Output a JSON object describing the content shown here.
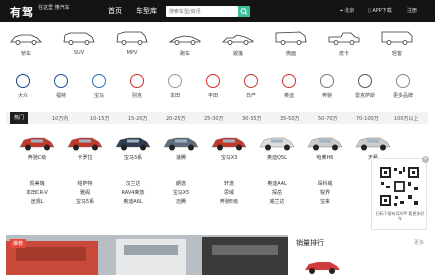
{
  "header": {
    "logo": "有驾",
    "slogan": "在这里 懂汽车",
    "nav_home": "首页",
    "nav_lib": "车型库",
    "search_placeholder": "搜索车型/资讯",
    "location": "北京",
    "app": "APP下载",
    "register": "注册"
  },
  "body_types": [
    {
      "label": "轿车",
      "icon": "sedan-icon"
    },
    {
      "label": "SUV",
      "icon": "suv-icon"
    },
    {
      "label": "MPV",
      "icon": "mpv-icon"
    },
    {
      "label": "跑车",
      "icon": "sports-car-icon"
    },
    {
      "label": "敞篷",
      "icon": "convertible-icon"
    },
    {
      "label": "微面",
      "icon": "van-icon"
    },
    {
      "label": "皮卡",
      "icon": "pickup-icon"
    },
    {
      "label": "轻客",
      "icon": "minibus-icon"
    }
  ],
  "brands": [
    {
      "label": "大众",
      "color": "#1b3f8b"
    },
    {
      "label": "福特",
      "color": "#1f4f9a"
    },
    {
      "label": "宝马",
      "color": "#2b6cb5"
    },
    {
      "label": "别克",
      "color": "#c9302c"
    },
    {
      "label": "本田",
      "color": "#999999"
    },
    {
      "label": "丰田",
      "color": "#d82b2b"
    },
    {
      "label": "日产",
      "color": "#c0392b"
    },
    {
      "label": "奥迪",
      "color": "#d32f2f"
    },
    {
      "label": "奔驰",
      "color": "#777777"
    },
    {
      "label": "雷克萨斯",
      "color": "#555555"
    },
    {
      "label": "更多品牌",
      "color": "#888888"
    }
  ],
  "tabs": [
    "热门",
    "10万内",
    "10-15万",
    "15-20万",
    "20-25万",
    "25-30万",
    "30-35万",
    "35-50万",
    "50-70万",
    "70-100万",
    "100万以上"
  ],
  "cars_row1": [
    {
      "name": "奔驰C级",
      "color": "#c0392b"
    },
    {
      "name": "卡罗拉",
      "color": "#c0392b"
    },
    {
      "name": "宝马3系",
      "color": "#2c3e50"
    },
    {
      "name": "速腾",
      "color": "#5d6d7e"
    },
    {
      "name": "宝马X3",
      "color": "#c0392b"
    },
    {
      "name": "奥迪Q5L",
      "color": "#dddddd"
    },
    {
      "name": "哈弗H6",
      "color": "#cccccc"
    },
    {
      "name": "天籁",
      "color": "#cccccc"
    }
  ],
  "cars_row2": [
    {
      "line1": "凯美瑞",
      "line2": "本田CR-V",
      "line3": "途观L"
    },
    {
      "line1": "帕萨特",
      "line2": "雅阁",
      "line3": "宝马5系"
    },
    {
      "line1": "汉兰达",
      "line2": "RAV4荣放",
      "line3": "奥迪A6L"
    },
    {
      "line1": "朗逸",
      "line2": "宝马X5",
      "line3": "迈腾"
    },
    {
      "line1": "轩逸",
      "line2": "思域",
      "line3": "奔驰E级"
    },
    {
      "line1": "奥迪A4L",
      "line2": "探岳",
      "line3": "威兰达"
    },
    {
      "line1": "昂科威",
      "line2": "锐界",
      "line3": "宝来"
    }
  ],
  "qr": {
    "text": "扫码下载有驾APP 看更多好车"
  },
  "banner": {
    "tag": "推荐"
  },
  "side": {
    "title": "销量排行",
    "more": "更多"
  }
}
